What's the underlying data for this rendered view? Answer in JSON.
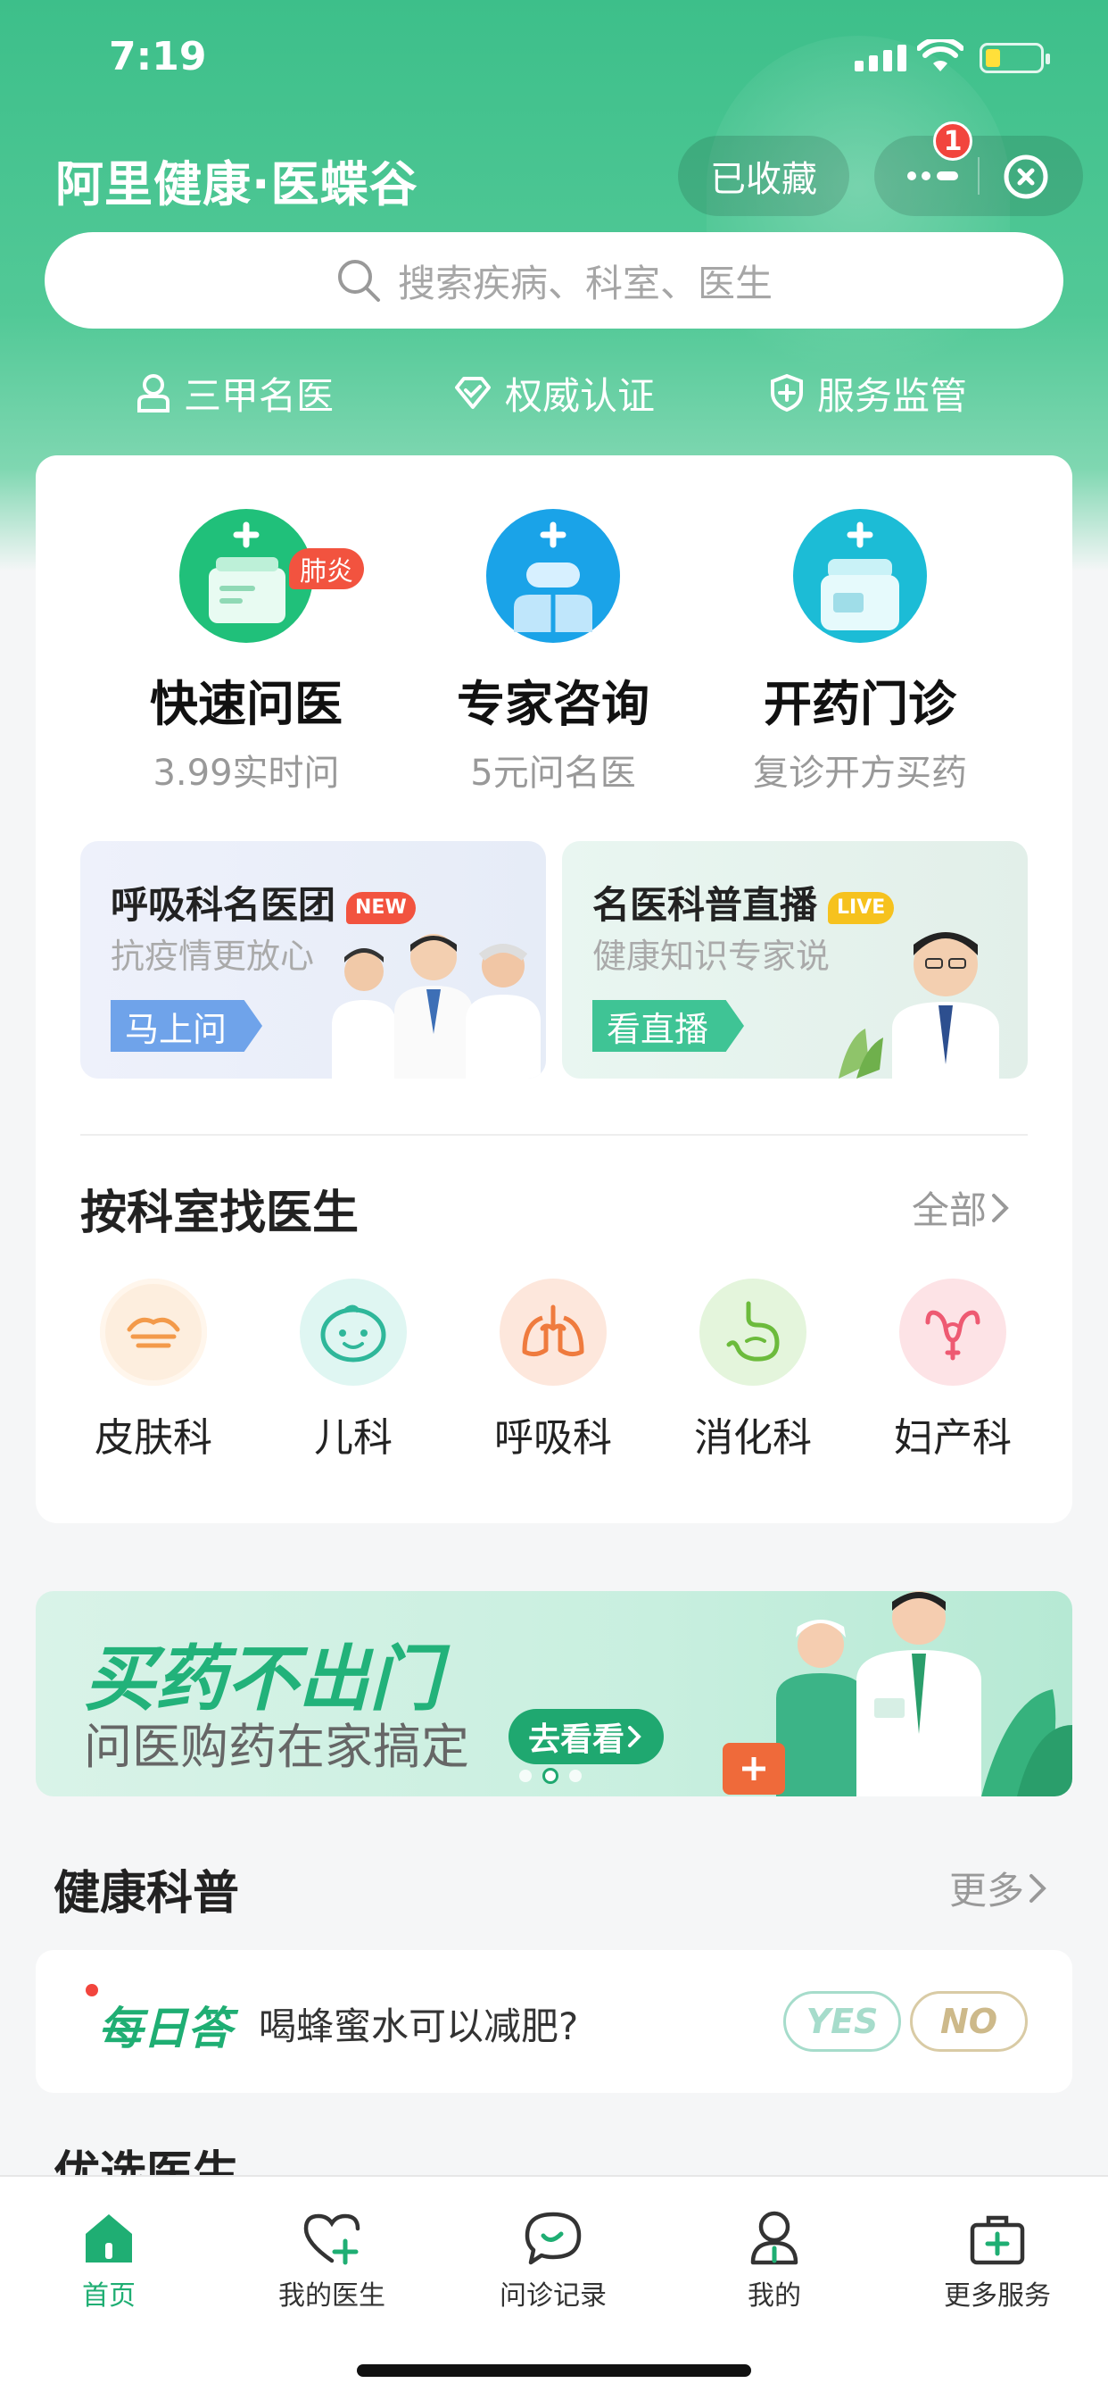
{
  "status_bar": {
    "time": "7:19"
  },
  "header": {
    "title": "阿里健康·医蝶谷",
    "favorite_label": "已收藏",
    "notification_count": "1"
  },
  "search": {
    "placeholder": "搜索疾病、科室、医生"
  },
  "trust_badges": [
    {
      "label": "三甲名医",
      "icon": "doctor-badge-icon"
    },
    {
      "label": "权威认证",
      "icon": "diamond-check-icon"
    },
    {
      "label": "服务监管",
      "icon": "shield-plus-icon"
    }
  ],
  "services": [
    {
      "title": "快速问医",
      "subtitle": "3.99实时问",
      "tag": "肺炎",
      "icon": "quick-consult-icon",
      "color": "#20c07a"
    },
    {
      "title": "专家咨询",
      "subtitle": "5元问名医",
      "icon": "expert-consult-icon",
      "color": "#1aa3e8"
    },
    {
      "title": "开药门诊",
      "subtitle": "复诊开方买药",
      "icon": "prescription-clinic-icon",
      "color": "#1cbcd6"
    }
  ],
  "promos": [
    {
      "title": "呼吸科名医团",
      "tag": "NEW",
      "subtitle": "抗疫情更放心",
      "button": "马上问"
    },
    {
      "title": "名医科普直播",
      "tag": "LIVE",
      "subtitle": "健康知识专家说",
      "button": "看直播"
    }
  ],
  "departments_section": {
    "title": "按科室找医生",
    "more": "全部",
    "items": [
      {
        "label": "皮肤科",
        "icon": "skin-icon"
      },
      {
        "label": "儿科",
        "icon": "child-face-icon"
      },
      {
        "label": "呼吸科",
        "icon": "lungs-icon"
      },
      {
        "label": "消化科",
        "icon": "stomach-icon"
      },
      {
        "label": "妇产科",
        "icon": "uterus-icon"
      }
    ]
  },
  "banner": {
    "headline": "买药不出门",
    "subline": "问医购药在家搞定",
    "button": "去看看",
    "active_slide": 2,
    "slide_count": 3
  },
  "health_section": {
    "title": "健康科普",
    "more": "更多"
  },
  "daily_qa": {
    "logo": "每日答",
    "question": "喝蜂蜜水可以减肥?",
    "yes": "YES",
    "no": "NO"
  },
  "next_section": {
    "title": "优选医生"
  },
  "tabbar": [
    {
      "label": "首页",
      "icon": "home-icon",
      "active": true
    },
    {
      "label": "我的医生",
      "icon": "heart-plus-icon",
      "active": false
    },
    {
      "label": "问诊记录",
      "icon": "chat-bubble-icon",
      "active": false
    },
    {
      "label": "我的",
      "icon": "user-icon",
      "active": false
    },
    {
      "label": "更多服务",
      "icon": "medkit-icon",
      "active": false
    }
  ],
  "colors": {
    "brand_green": "#1fae73",
    "hero_green": "#3dbf8a",
    "alert_red": "#f2453d"
  }
}
